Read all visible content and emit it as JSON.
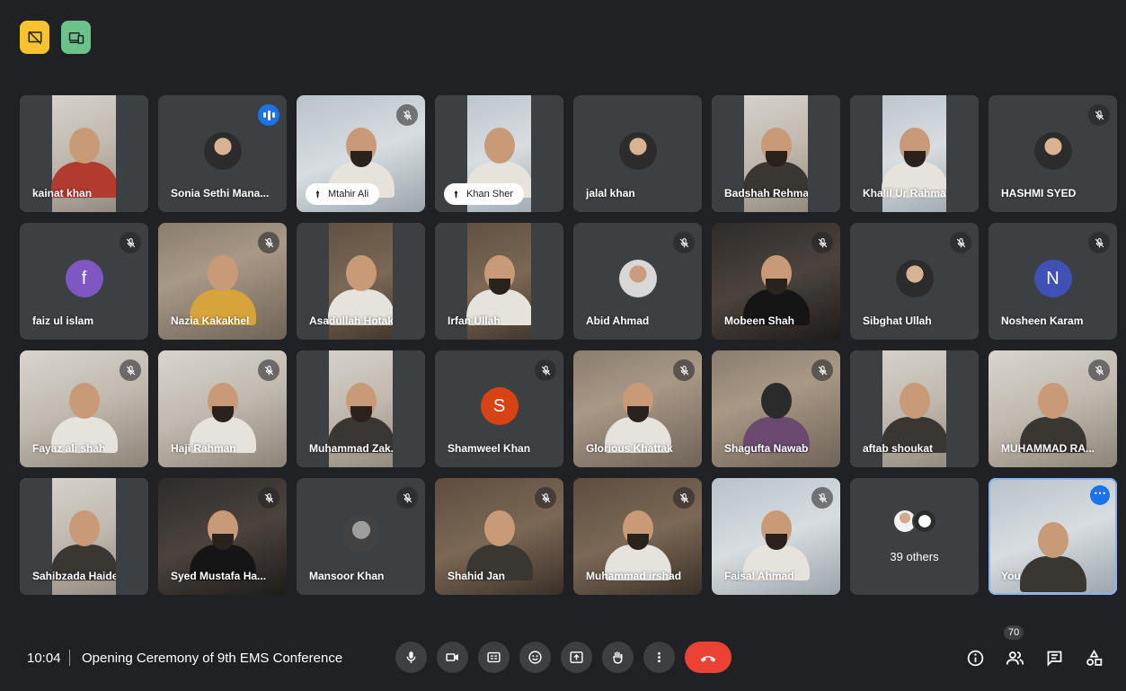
{
  "meeting": {
    "time": "10:04",
    "title": "Opening Ceremony of 9th EMS Conference",
    "participant_count": "70"
  },
  "top_badges": [
    {
      "icon": "present-off-icon",
      "color": "#f9c22e"
    },
    {
      "icon": "devices-icon",
      "color": "#6dc28a"
    }
  ],
  "tiles": [
    {
      "name": "kainat khan",
      "state": "muted"
    },
    {
      "name": "Sonia Sethi Mana...",
      "state": "speaking"
    },
    {
      "name": "Mtahir Ali",
      "state": "muted",
      "pinned": true
    },
    {
      "name": "Khan Sher",
      "state": "muted",
      "pinned": true
    },
    {
      "name": "jalal khan",
      "state": "none"
    },
    {
      "name": "Badshah Rehman",
      "state": "none"
    },
    {
      "name": "Khalil Ur Rahman",
      "state": "muted"
    },
    {
      "name": "HASHMI SYED",
      "state": "muted"
    },
    {
      "name": "faiz ul islam",
      "state": "muted",
      "initial": "f",
      "color": "#7e57c2"
    },
    {
      "name": "Nazia Kakakhel",
      "state": "muted"
    },
    {
      "name": "Asadullah Hotak",
      "state": "muted"
    },
    {
      "name": "Irfan Ullah",
      "state": "muted"
    },
    {
      "name": "Abid Ahmad",
      "state": "muted"
    },
    {
      "name": "Mobeen Shah",
      "state": "muted"
    },
    {
      "name": "Sibghat Ullah",
      "state": "muted"
    },
    {
      "name": "Nosheen Karam",
      "state": "muted",
      "initial": "N",
      "color": "#3f51b5"
    },
    {
      "name": "Fayaz ali shah",
      "state": "muted"
    },
    {
      "name": "Haji Rahman",
      "state": "muted"
    },
    {
      "name": "Muhammad Zak...",
      "state": "muted"
    },
    {
      "name": "Shamweel Khan",
      "state": "muted",
      "initial": "S",
      "color": "#d84315"
    },
    {
      "name": "Glorious Khattak",
      "state": "muted"
    },
    {
      "name": "Shagufta Nawab",
      "state": "muted"
    },
    {
      "name": "aftab shoukat",
      "state": "muted"
    },
    {
      "name": "MUHAMMAD RA...",
      "state": "muted"
    },
    {
      "name": "Sahibzada Haide...",
      "state": "muted"
    },
    {
      "name": "Syed Mustafa Ha...",
      "state": "muted"
    },
    {
      "name": "Mansoor Khan",
      "state": "muted"
    },
    {
      "name": "Shahid Jan",
      "state": "muted"
    },
    {
      "name": "Muhammad irshad",
      "state": "muted"
    },
    {
      "name": "Faisal Ahmad",
      "state": "muted"
    },
    {
      "name": "39 others",
      "state": "others"
    },
    {
      "name": "You",
      "state": "self"
    }
  ],
  "controls": [
    "mic-icon",
    "camera-icon",
    "captions-icon",
    "emoji-icon",
    "present-icon",
    "raise-hand-icon",
    "more-options-icon",
    "end-call-icon"
  ],
  "right_controls": [
    "info-icon",
    "people-icon",
    "chat-icon",
    "activities-icon"
  ]
}
